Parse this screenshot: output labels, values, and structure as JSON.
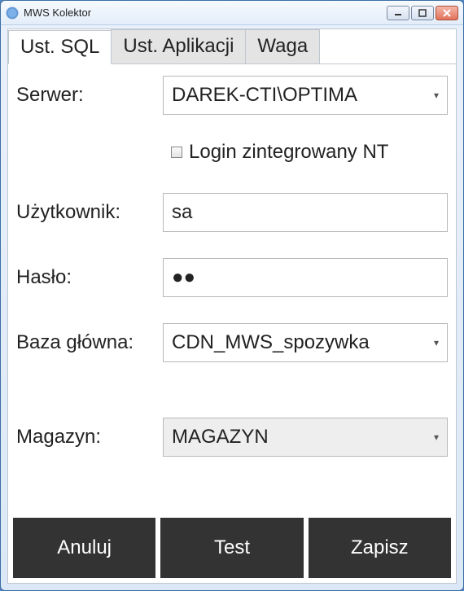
{
  "window": {
    "title": "MWS Kolektor"
  },
  "tabs": {
    "sql": "Ust. SQL",
    "app": "Ust. Aplikacji",
    "waga": "Waga"
  },
  "form": {
    "server_label": "Serwer:",
    "server_value": "DAREK-CTI\\OPTIMA",
    "nt_login_label": "Login zintegrowany NT",
    "user_label": "Użytkownik:",
    "user_value": "sa",
    "password_label": "Hasło:",
    "password_value": "●●",
    "maindb_label": "Baza główna:",
    "maindb_value": "CDN_MWS_spozywka",
    "warehouse_label": "Magazyn:",
    "warehouse_value": "MAGAZYN"
  },
  "buttons": {
    "cancel": "Anuluj",
    "test": "Test",
    "save": "Zapisz"
  }
}
